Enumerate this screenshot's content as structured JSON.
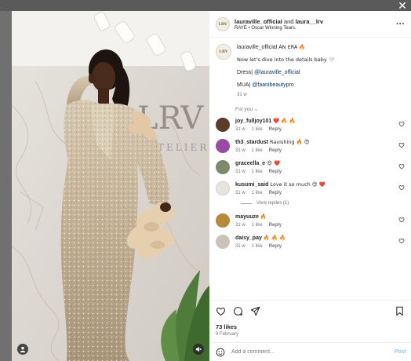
{
  "window": {
    "close_glyph": "✕"
  },
  "media": {
    "wall_sign_letters": "LRV",
    "wall_sign_sub": "ATELIER",
    "user_icon": "person-icon",
    "mute_icon": "muted-speaker-icon"
  },
  "post_header": {
    "author": "lauraville_official",
    "conjunction": "and",
    "collaborator": "laura__lrv",
    "audio": "RAYE • Oscar Winning Tears.",
    "avatar_text": "LRV"
  },
  "caption": {
    "author": "lauraville_official",
    "text": "AN ERA 🔥",
    "line2": "Now let's dive into the details baby 🤍",
    "dress_label": "Dress|",
    "dress_mention": "@lauraville_official",
    "mua_label": "MUA|",
    "mua_mention": "@faanibeautypro",
    "time": "31 w"
  },
  "for_you": "For you ⌄",
  "comments": [
    {
      "user": "joy_fulljoy101",
      "text": "❤️ 🔥 🔥",
      "time": "31 w",
      "likes": "1 like",
      "reply": "Reply",
      "avatar_color": "#5b3a2a"
    },
    {
      "user": "th3_stardust",
      "text": "Ravishing 🔥 😍",
      "time": "31 w",
      "likes": "1 like",
      "reply": "Reply",
      "avatar_color": "#9b4aa8"
    },
    {
      "user": "graceella_e",
      "text": "😍 ❤️",
      "time": "31 w",
      "likes": "1 like",
      "reply": "Reply",
      "avatar_color": "#7a8a6b"
    },
    {
      "user": "kusumi_said",
      "text": "Love it so much 😍 ❤️",
      "time": "31 w",
      "likes": "1 like",
      "reply": "Reply",
      "avatar_color": "#e9e4df"
    },
    {
      "user": "mayuuze",
      "text": "🔥",
      "time": "31 w",
      "likes": "1 like",
      "reply": "Reply",
      "avatar_color": "#b9893a"
    },
    {
      "user": "daisy_pay",
      "text": "🔥 🔥 🔥",
      "time": "31 w",
      "likes": "1 like",
      "reply": "Reply",
      "avatar_color": "#c9c3b8"
    }
  ],
  "view_replies": "View replies (1)",
  "actions": {
    "likes": "73 likes",
    "date": "9 February",
    "icons": [
      "heart-icon",
      "comment-icon",
      "share-icon",
      "bookmark-icon"
    ]
  },
  "add_comment": {
    "placeholder": "Add a comment...",
    "post_label": "Post"
  },
  "colors": {
    "link": "#00376b",
    "muted": "#737373",
    "text": "#262626",
    "post_button": "#93c6f7",
    "like_red": "#ff3040"
  }
}
